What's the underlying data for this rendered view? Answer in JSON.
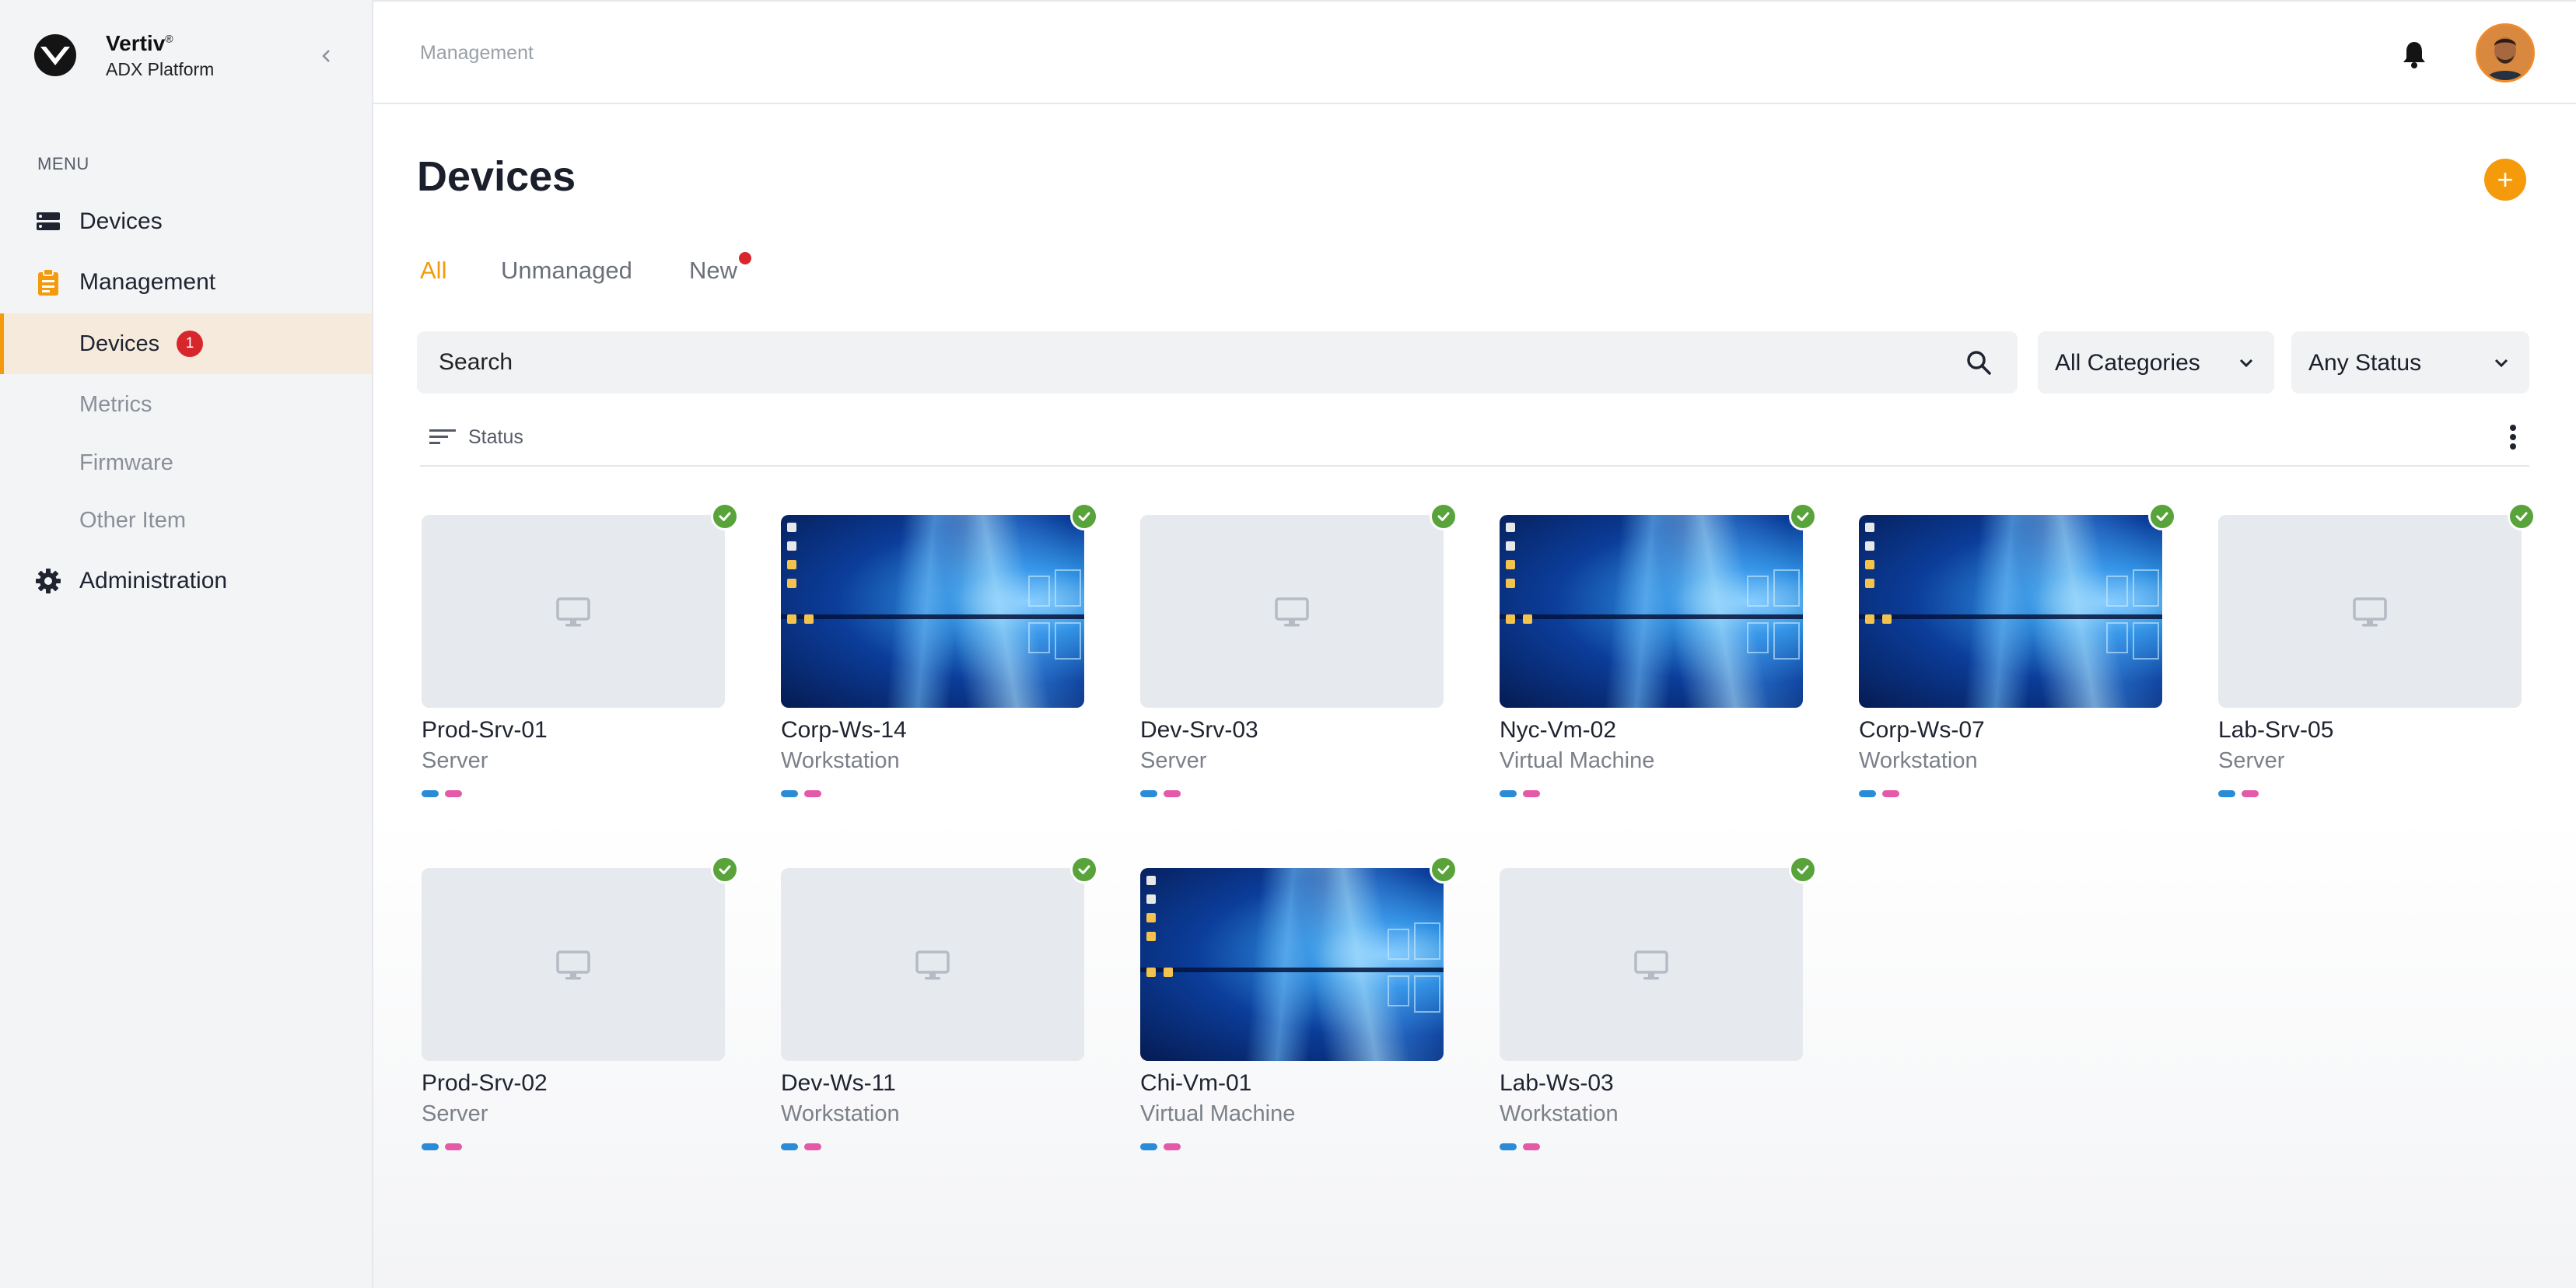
{
  "brand": {
    "name": "Vertiv",
    "mark": "®",
    "product": "ADX Platform"
  },
  "sidebar": {
    "menu_heading": "MENU",
    "items": [
      {
        "label": "Devices",
        "icon": "server-stack-icon"
      },
      {
        "label": "Management",
        "icon": "clipboard-icon"
      },
      {
        "label": "Devices",
        "badge": "1",
        "active": true
      },
      {
        "label": "Metrics"
      },
      {
        "label": "Firmware"
      },
      {
        "label": "Other Item"
      },
      {
        "label": "Administration",
        "icon": "gear-icon"
      }
    ]
  },
  "header": {
    "breadcrumb": "Management"
  },
  "main": {
    "title": "Devices",
    "add_label": "+",
    "tabs": [
      {
        "label": "All",
        "active": true
      },
      {
        "label": "Unmanaged"
      },
      {
        "label": "New",
        "has_dot": true
      }
    ],
    "search": {
      "placeholder": "Search"
    },
    "filters": {
      "category": "All Categories",
      "status": "Any Status"
    },
    "sort_label": "Status"
  },
  "colors": {
    "accent": "#f59a0a",
    "badge": "#d8262d",
    "status_ok": "#58a33a",
    "pill_blue": "#2a8bd6",
    "pill_pink": "#e45aa8"
  },
  "devices": [
    {
      "name": "Prod-Srv-01",
      "type": "Server",
      "preview": "none"
    },
    {
      "name": "Corp-Ws-14",
      "type": "Workstation",
      "preview": "desktop"
    },
    {
      "name": "Dev-Srv-03",
      "type": "Server",
      "preview": "none"
    },
    {
      "name": "Nyc-Vm-02",
      "type": "Virtual Machine",
      "preview": "desktop"
    },
    {
      "name": "Corp-Ws-07",
      "type": "Workstation",
      "preview": "desktop"
    },
    {
      "name": "Lab-Srv-05",
      "type": "Server",
      "preview": "none"
    },
    {
      "name": "Prod-Srv-02",
      "type": "Server",
      "preview": "none"
    },
    {
      "name": "Dev-Ws-11",
      "type": "Workstation",
      "preview": "none"
    },
    {
      "name": "Chi-Vm-01",
      "type": "Virtual Machine",
      "preview": "desktop"
    },
    {
      "name": "Lab-Ws-03",
      "type": "Workstation",
      "preview": "none"
    }
  ]
}
